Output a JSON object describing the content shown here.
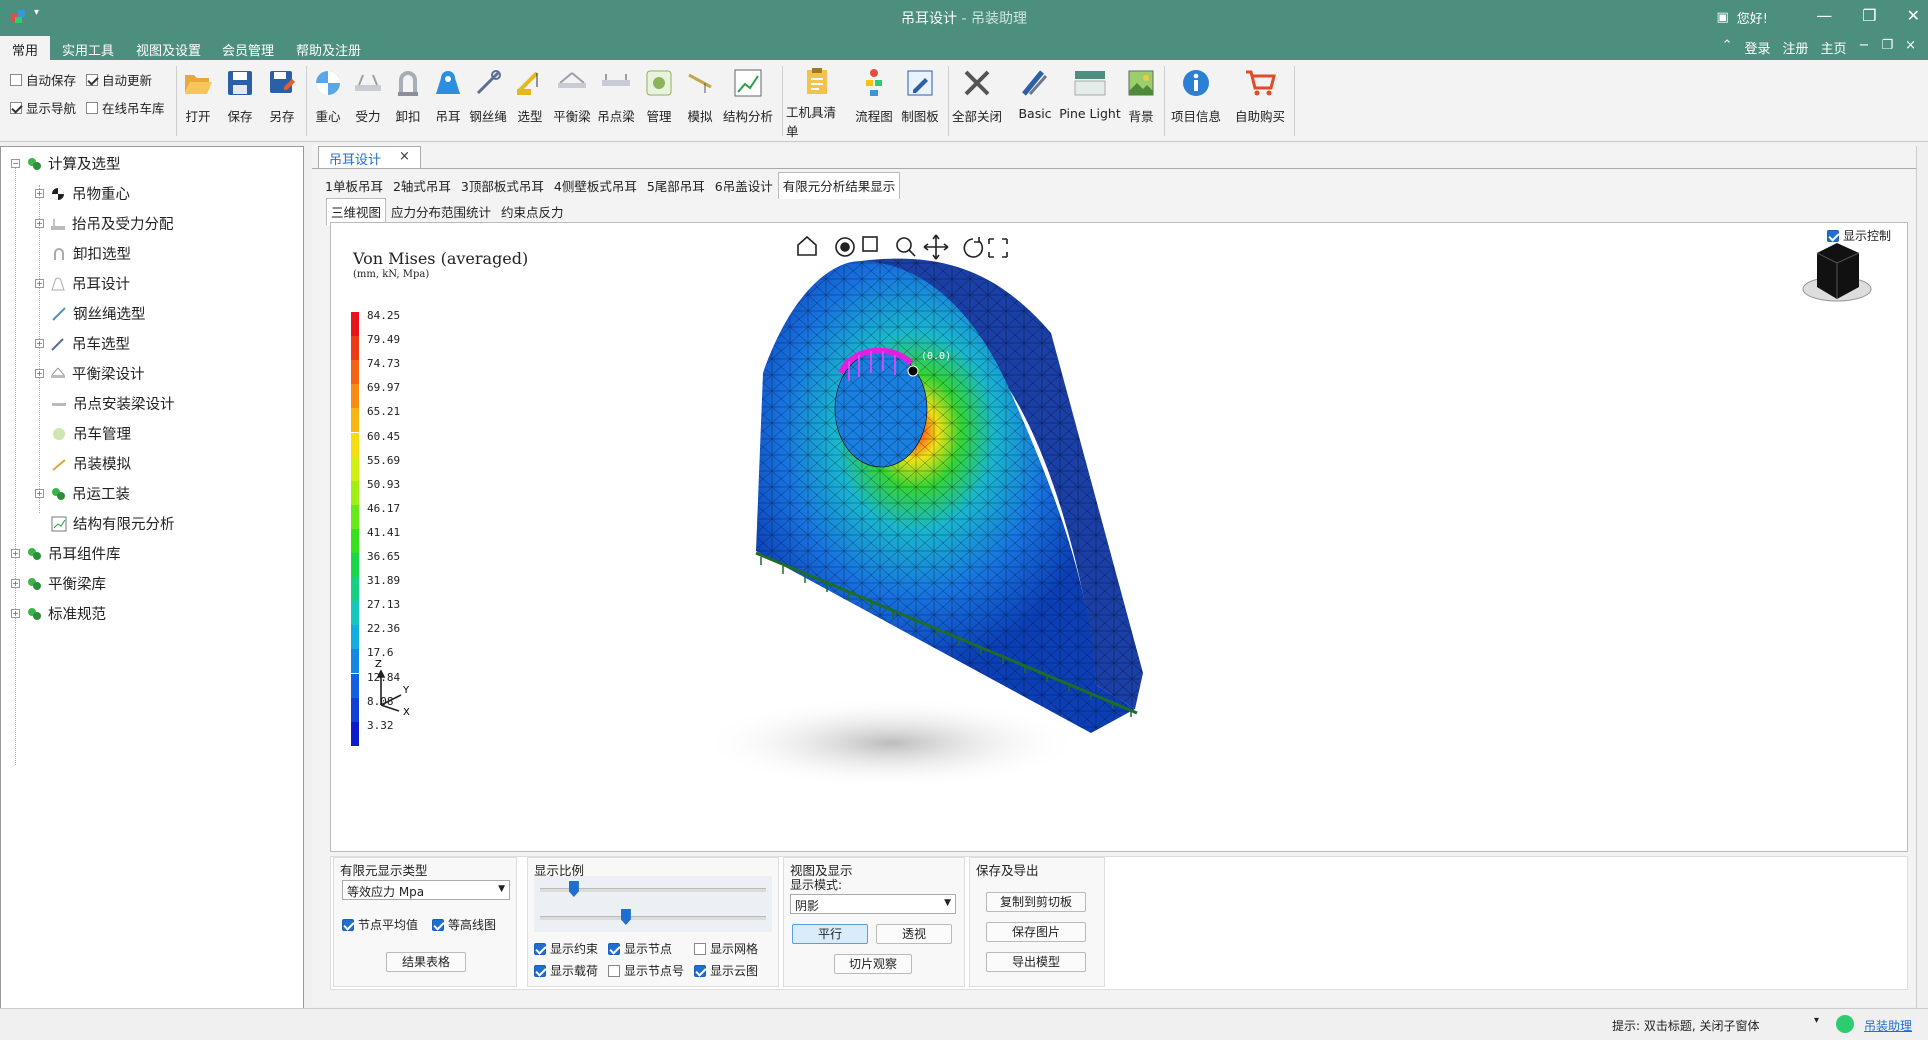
{
  "window": {
    "title": "吊耳设计",
    "subtitle": " - 吊装助理",
    "greeting": "您好!"
  },
  "menu": {
    "items": [
      "常用",
      "实用工具",
      "视图及设置",
      "会员管理",
      "帮助及注册"
    ],
    "right": [
      "登录",
      "注册",
      "主页"
    ]
  },
  "ribbon": {
    "checks": [
      {
        "label": "自动保存",
        "checked": false
      },
      {
        "label": "自动更新",
        "checked": true
      },
      {
        "label": "显示导航",
        "checked": true
      },
      {
        "label": "在线吊车库",
        "checked": false
      }
    ],
    "buttons": [
      "打开",
      "保存",
      "另存",
      "重心",
      "受力",
      "卸扣",
      "吊耳",
      "钢丝绳",
      "选型",
      "平衡梁",
      "吊点梁",
      "管理",
      "模拟",
      "结构分析",
      "工机具清单",
      "流程图",
      "制图板",
      "全部关闭",
      "Basic",
      "Pine Light",
      "背景",
      "项目信息",
      "自助购买"
    ]
  },
  "tree": {
    "root": "计算及选型",
    "children": [
      "吊物重心",
      "抬吊及受力分配",
      "卸扣选型",
      "吊耳设计",
      "钢丝绳选型",
      "吊车选型",
      "平衡梁设计",
      "吊点安装梁设计",
      "吊车管理",
      "吊装模拟",
      "吊运工装",
      "结构有限元分析"
    ],
    "others": [
      "吊耳组件库",
      "平衡梁库",
      "标准规范"
    ]
  },
  "doc_tab": {
    "label": "吊耳设计",
    "close": "×"
  },
  "tabs": [
    "1单板吊耳",
    "2轴式吊耳",
    "3顶部板式吊耳",
    "4侧壁板式吊耳",
    "5尾部吊耳",
    "6吊盖设计",
    "有限元分析结果显示"
  ],
  "subtabs": [
    "三维视图",
    "应力分布范围统计",
    "约束点反力"
  ],
  "viewport": {
    "title": "Von Mises (averaged)",
    "units": "(mm, kN, Mpa)",
    "show_control": "显示控制",
    "node_label": "(0.0)",
    "axis": {
      "z": "Z",
      "y": "Y",
      "x": "X"
    },
    "legend_values": [
      "84.25",
      "79.49",
      "74.73",
      "69.97",
      "65.21",
      "60.45",
      "55.69",
      "50.93",
      "46.17",
      "41.41",
      "36.65",
      "31.89",
      "27.13",
      "22.36",
      "17.6",
      "12.84",
      "8.08",
      "3.32"
    ],
    "legend_colors": [
      "#e8141a",
      "#ee3a16",
      "#f46214",
      "#f88c12",
      "#fab610",
      "#f6dd10",
      "#d2ef12",
      "#a0ee14",
      "#68ea18",
      "#34e21e",
      "#18d84a",
      "#16d083",
      "#14c8bd",
      "#12aee0",
      "#1288e4",
      "#1262e0",
      "#1040d8",
      "#0c1ccc"
    ]
  },
  "panel": {
    "fea_type": {
      "title": "有限元显示类型",
      "value": "等效应力 Mpa",
      "node_avg": "节点平均值",
      "contour": "等高线图",
      "result_table": "结果表格"
    },
    "scale": {
      "title": "显示比例",
      "slider1": 0.15,
      "slider2": 0.38,
      "checks": [
        {
          "label": "显示约束",
          "on": true
        },
        {
          "label": "显示节点",
          "on": true
        },
        {
          "label": "显示网格",
          "on": false
        },
        {
          "label": "显示载荷",
          "on": true
        },
        {
          "label": "显示节点号",
          "on": false
        },
        {
          "label": "显示云图",
          "on": true
        }
      ]
    },
    "view": {
      "title": "视图及显示",
      "mode_label": "显示模式:",
      "mode_value": "阴影",
      "parallel": "平行",
      "perspective": "透视",
      "slice": "切片观察"
    },
    "save": {
      "title": "保存及导出",
      "copy": "复制到剪切板",
      "save_img": "保存图片",
      "export": "导出模型"
    }
  },
  "status": {
    "hint": "提示: 双击标题, 关闭子窗体",
    "link": "吊装助理"
  }
}
